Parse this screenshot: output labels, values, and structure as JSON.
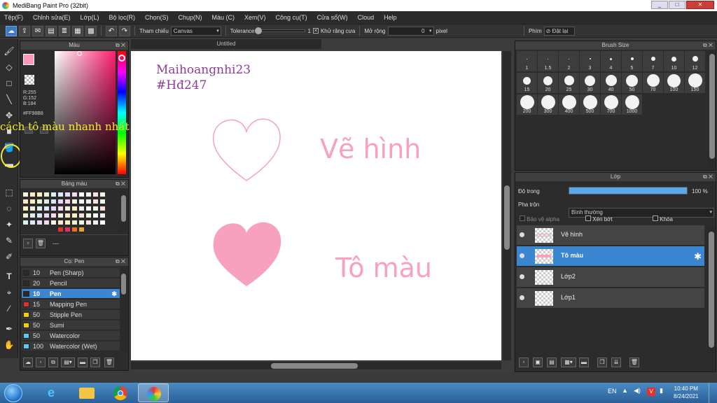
{
  "window": {
    "title": "MediBang Paint Pro (32bit)",
    "min": "_",
    "max": "□",
    "close": "✕"
  },
  "menu": [
    "Tệp(F)",
    "Chỉnh sửa(E)",
    "Lớp(L)",
    "Bộ lọc(R)",
    "Chọn(S)",
    "Chụp(N)",
    "Màu (C)",
    "Xem(V)",
    "Công cụ(T)",
    "Cửa sổ(W)",
    "Cloud",
    "Help"
  ],
  "toolbar": {
    "tham_chieu_label": "Tham chiếu",
    "tham_chieu_value": "Canvas",
    "tolerance_label": "Tolerance",
    "tolerance_value": "1",
    "khu_rang_cua": "Khử răng cưa",
    "mo_rong_label": "Mở rộng",
    "mo_rong_value": "0",
    "pixel_label": "pixel",
    "phim_label": "Phím",
    "dat_lai_label": "Đặt lại"
  },
  "color_panel": {
    "title": "Màu",
    "r": "R:255",
    "g": "G:152",
    "b": "B:184",
    "hex": "#FF98B8",
    "primary": "#FF98B8"
  },
  "overlay_caption": "cách tô màu nhanh nhất",
  "palette_panel": {
    "title": "Bảng màu",
    "name": "---"
  },
  "brush_panel": {
    "title": "Cọ: Pen",
    "items": [
      {
        "size": "10",
        "name": "Pen (Sharp)",
        "color": "#2a2a2a"
      },
      {
        "size": "20",
        "name": "Pencil",
        "color": "#2a2a2a"
      },
      {
        "size": "10",
        "name": "Pen",
        "color": "#2a2a2a"
      },
      {
        "size": "15",
        "name": "Mapping Pen",
        "color": "#e03030"
      },
      {
        "size": "50",
        "name": "Stipple Pen",
        "color": "#f0d000"
      },
      {
        "size": "50",
        "name": "Sumi",
        "color": "#f0d000"
      },
      {
        "size": "50",
        "name": "Watercolor",
        "color": "#60c8f0"
      },
      {
        "size": "100",
        "name": "Watercolor (Wet)",
        "color": "#60c8f0"
      }
    ]
  },
  "canvas": {
    "tab": "Untitled",
    "text1": "Maihoangnhi23",
    "text2": "#Hđ247",
    "label_draw": "Vẽ hình",
    "label_fill": "Tô màu",
    "heart_color": "#F7A1BE",
    "text_color": "#8e3b9a"
  },
  "brush_size_panel": {
    "title": "Brush Size",
    "sizes": [
      "1",
      "1.5",
      "2",
      "3",
      "4",
      "5",
      "7",
      "10",
      "12",
      "15",
      "20",
      "25",
      "30",
      "40",
      "50",
      "70",
      "100",
      "150",
      "200",
      "300",
      "400",
      "500",
      "700",
      "1000"
    ]
  },
  "layer_panel": {
    "title": "Lớp",
    "opacity_label": "Độ trong",
    "opacity_value": "100 %",
    "opacity": 1.0,
    "blend_label": "Pha trộn",
    "blend_value": "Bình thường",
    "protect_alpha": "Bảo vệ alpha",
    "clip": "Xén bớt",
    "lock": "Khóa",
    "layers": [
      {
        "name": "Vẽ hình"
      },
      {
        "name": "Tô màu"
      },
      {
        "name": "Lớp2"
      },
      {
        "name": "Lớp1"
      }
    ]
  },
  "taskbar": {
    "lang": "EN",
    "time": "10:40 PM",
    "date": "8/24/2021"
  }
}
